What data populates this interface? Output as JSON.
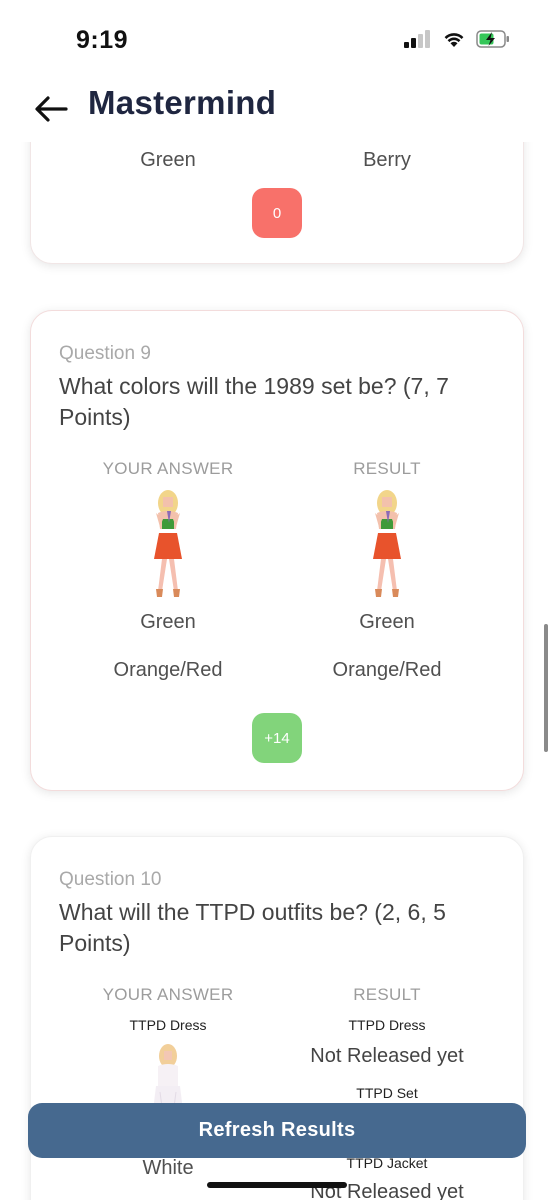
{
  "status_bar": {
    "time": "9:19",
    "signal_icon": "signal-bars-icon",
    "wifi_icon": "wifi-icon",
    "battery_icon": "battery-charging-icon"
  },
  "header": {
    "title": "Mastermind",
    "back_icon": "arrow-left-icon"
  },
  "prev_card": {
    "answer": "Green",
    "result": "Berry",
    "score": "0",
    "score_color": "#f8716a"
  },
  "question9": {
    "number": "Question 9",
    "text": "What colors will the 1989 set be? (7, 7 Points)",
    "your_answer_label": "YOUR ANSWER",
    "result_label": "RESULT",
    "answer_values": [
      "Green",
      "Orange/Red"
    ],
    "result_values": [
      "Green",
      "Orange/Red"
    ],
    "score": "+14",
    "score_color": "#82d47b"
  },
  "question10": {
    "number": "Question 10",
    "text": "What will the TTPD outfits be? (2, 6, 5 Points)",
    "your_answer_label": "YOUR ANSWER",
    "result_label": "RESULT",
    "answer_item_label": "TTPD Dress",
    "answer_value": "White",
    "result_items": [
      {
        "label": "TTPD Dress",
        "value": "Not Released yet"
      },
      {
        "label": "TTPD Set",
        "value": ""
      },
      {
        "label": "TTPD Jacket",
        "value": "Not Released yet"
      }
    ]
  },
  "refresh_button": {
    "label": "Refresh Results",
    "color": "#46698f"
  }
}
